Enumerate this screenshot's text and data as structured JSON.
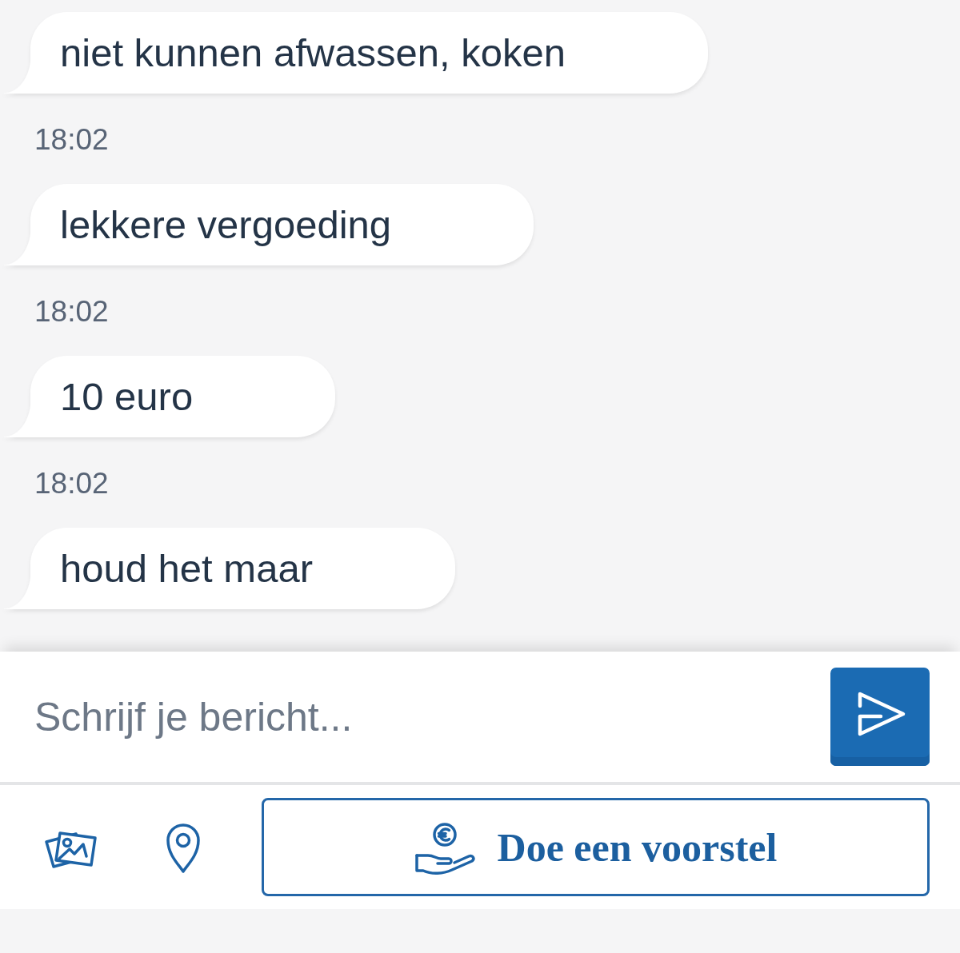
{
  "messages": [
    {
      "text": "niet kunnen afwassen, koken",
      "time": "18:02"
    },
    {
      "text": "lekkere vergoeding",
      "time": "18:02"
    },
    {
      "text": "10 euro",
      "time": "18:02"
    },
    {
      "text": "houd het maar"
    }
  ],
  "composer": {
    "placeholder": "Schrijf je bericht..."
  },
  "actions": {
    "offer_button": "Doe een voorstel"
  }
}
